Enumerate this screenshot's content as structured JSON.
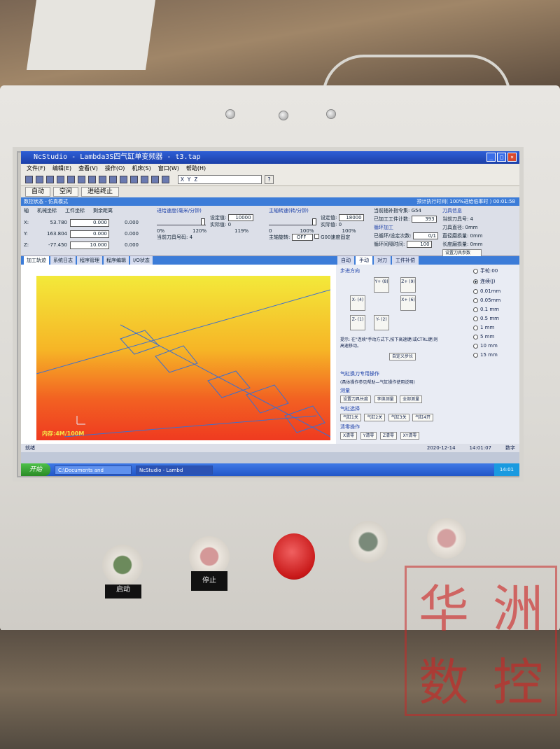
{
  "window": {
    "title": "NcStudio - Lambda3S四气缸单变频器 - t3.tap",
    "controls": [
      "_",
      "□",
      "×"
    ]
  },
  "menu": [
    "文件(F)",
    "编辑(E)",
    "查看(V)",
    "操作(O)",
    "机床(S)",
    "窗口(W)",
    "帮助(H)"
  ],
  "toolbar": {
    "coord_field": "X    Y    Z",
    "help": "?"
  },
  "mode_buttons": [
    "自动",
    "空闲",
    "进给终止"
  ],
  "status": {
    "left": "数控状态 - 仿真模式",
    "right": "预计执行时间( 100%进给倍率时 ) 00:01:58"
  },
  "coords": {
    "headers": [
      "轴",
      "机械坐标",
      "工件坐标",
      "剩余距离"
    ],
    "rows": [
      {
        "axis": "X:",
        "machine": "53.780",
        "work": "0.000",
        "remain": "0.000"
      },
      {
        "axis": "Y:",
        "machine": "163.804",
        "work": "0.000",
        "remain": "0.000"
      },
      {
        "axis": "Z:",
        "machine": "-77.450",
        "work": "10.000",
        "remain": "0.000"
      }
    ]
  },
  "feed": {
    "title": "进给速度(毫米/分钟)",
    "set_label": "设定值:",
    "set_value": "10000",
    "actual_label": "实际值:",
    "actual_value": "0",
    "min": "0%",
    "max": "120%",
    "percent": "119%",
    "tool_label": "当前刀具号码:",
    "tool_value": "4",
    "override_level": 0.99
  },
  "spindle": {
    "title": "主轴转速(转/分钟)",
    "set_label": "设定值:",
    "set_value": "18000",
    "actual_label": "实际值:",
    "actual_value": "0",
    "min": "0",
    "max": "100%",
    "percent": "100%",
    "rotate_label": "主轴旋转:",
    "rotate_value": "OFF",
    "g00_label": "G00速度固定",
    "override_level": 1.0
  },
  "machining": {
    "cmd_label": "当前插补指令集:",
    "cmd_value": "G54",
    "count_label": "已加工工件计数:",
    "count_value": "393",
    "loop_title": "循环加工",
    "loop_label": "已循环/设定次数:",
    "loop_value": "0/1",
    "interval_label": "循环间隔时间:",
    "interval_value": "100"
  },
  "tool_info": {
    "title": "刀具信息",
    "lines": [
      "当前刀具号: 4",
      "刀具直径: 0mm",
      "直径磨损量: 0mm",
      "长度磨损量: 0mm"
    ],
    "button": "设置刀具参数"
  },
  "left_tabs": [
    "加工轨迹",
    "系统日志",
    "程序管理",
    "程序编辑",
    "I/O状态"
  ],
  "graph": {
    "memory": "内存:4M/100M"
  },
  "right_tabs": [
    "自动",
    "手动",
    "对刀",
    "工件补偿"
  ],
  "jog": {
    "title": "步进方向",
    "buttons": [
      "Y+\n(8)",
      "Z+\n(9)",
      "X-\n(4)",
      "X+\n(6)",
      "Z-\n(1)",
      "Y-\n(2)"
    ],
    "hint": "提示: 在\"连续\"手动方式下,按下高速键(或CTRL键)则高速移动。",
    "custom_btn": "自定义步长"
  },
  "steps": [
    "手轮:00",
    "连续(J)",
    "0.01mm",
    "0.05mm",
    "0.1 mm",
    "0.5 mm",
    "1 mm",
    "5 mm",
    "10 mm",
    "15 mm"
  ],
  "cylinder": {
    "title": "气缸换刀专用操作",
    "note": "(具体操作参见帮助—气缸操作使用说明)",
    "measure_title": "测量",
    "measure_btns": [
      "设置刀具长度",
      "李焕测量",
      "全部测量"
    ],
    "select_title": "气缸选择",
    "select_btns": [
      "气缸1关",
      "气缸2关",
      "气缸3关",
      "气缸4开"
    ],
    "clear_title": "清零操作",
    "clear_btns": [
      "X清零",
      "Y清零",
      "Z清零",
      "XY清零"
    ]
  },
  "bottom_status": {
    "left": "就绪",
    "date": "2020-12-14",
    "time": "14:01:07",
    "mode": "数字"
  },
  "taskbar": {
    "start": "开始",
    "tasks": [
      "C:\\Documents and",
      "NcStudio - Lambd"
    ],
    "clock": "14:01"
  },
  "hardware": {
    "start_label": "启动",
    "stop_label": "停止"
  },
  "watermark": [
    "华",
    "洲",
    "数",
    "控"
  ]
}
